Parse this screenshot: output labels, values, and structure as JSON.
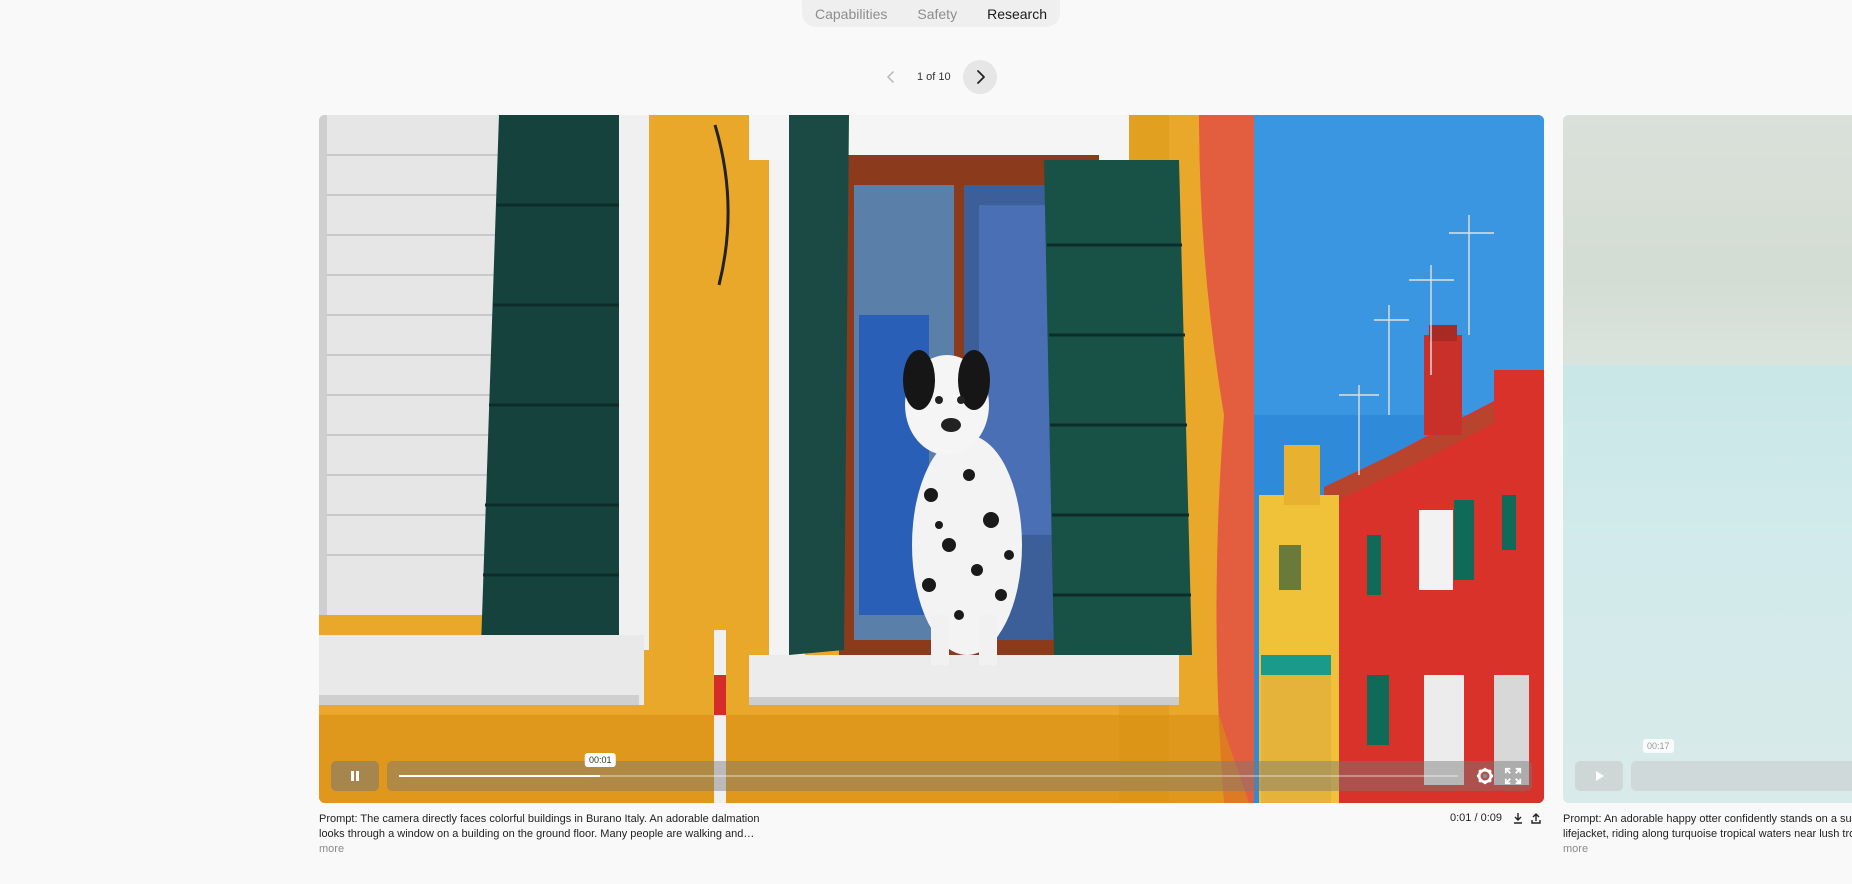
{
  "tabs": [
    {
      "label": "Capabilities"
    },
    {
      "label": "Safety"
    },
    {
      "label": "Research"
    }
  ],
  "pager": {
    "text": "1 of 10"
  },
  "videos": [
    {
      "time_tooltip": "00:01",
      "progress": 0.19,
      "time_display": "0:01 / 0:09",
      "prompt_line1": "Prompt: The camera directly faces colorful buildings in Burano Italy. An adorable dalmation",
      "prompt_line2": "looks through a window on a building on the ground floor. Many people are walking and…",
      "more_label": "more"
    },
    {
      "time_tooltip": "00:17",
      "prompt_line1": "Prompt: An adorable happy otter confidently stands on a surfb",
      "prompt_line2": "lifejacket, riding along turquoise tropical waters near lush tropi",
      "more_label": "more"
    }
  ],
  "icons": {
    "prev": "chevron-left-icon",
    "next": "chevron-right-icon",
    "pause": "pause-icon",
    "play": "play-icon",
    "settings": "gear-icon",
    "fullscreen": "fullscreen-icon",
    "download": "download-icon",
    "share": "share-icon"
  },
  "colors": {
    "wall_yellow": "#e7a726",
    "shutter_green": "#1c4a44",
    "sky": "#2f8bd9",
    "red_building": "#d9322b"
  }
}
